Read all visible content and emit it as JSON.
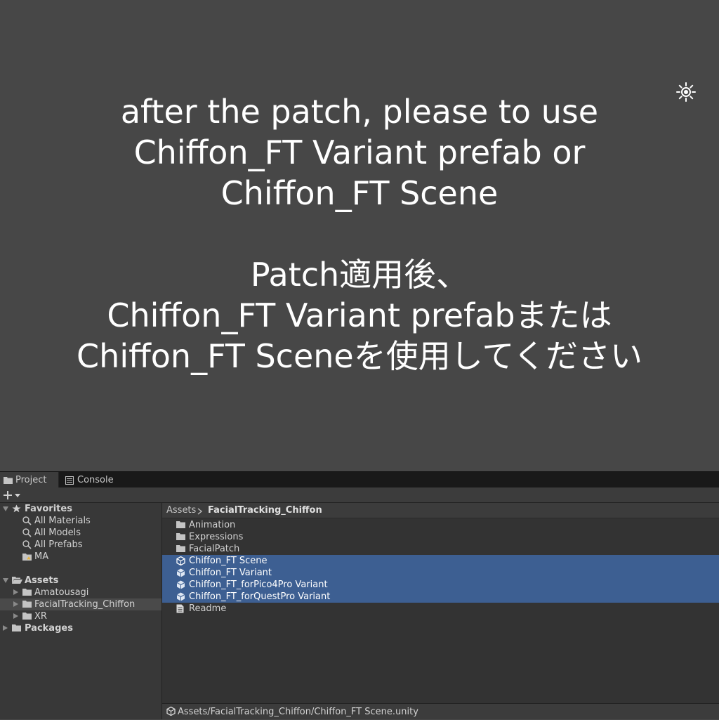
{
  "message": {
    "english_lines": [
      "after the patch, please to use",
      "Chiffon_FT Variant prefab or",
      "Chiffon_FT Scene"
    ],
    "japanese_lines": [
      "Patch適用後、",
      "Chiffon_FT Variant prefabまたは",
      "Chiffon_FT Sceneを使用してください"
    ],
    "icon": "sun-icon"
  },
  "tabs": [
    {
      "label": "Project",
      "icon": "folder-icon",
      "active": true
    },
    {
      "label": "Console",
      "icon": "console-icon",
      "active": false
    }
  ],
  "toolbar": {
    "add_icon": "plus-dropdown-icon"
  },
  "favorites": {
    "label": "Favorites",
    "items": [
      {
        "label": "All Materials",
        "icon": "search-icon"
      },
      {
        "label": "All Models",
        "icon": "search-icon"
      },
      {
        "label": "All Prefabs",
        "icon": "search-icon"
      },
      {
        "label": "MA",
        "icon": "folder-star-icon"
      }
    ]
  },
  "assets_tree": {
    "label": "Assets",
    "children": [
      {
        "label": "Amatousagi",
        "icon": "folder-icon"
      },
      {
        "label": "FacialTracking_Chiffon",
        "icon": "folder-icon",
        "selected": true
      },
      {
        "label": "XR",
        "icon": "folder-icon"
      }
    ]
  },
  "packages": {
    "label": "Packages"
  },
  "breadcrumb": {
    "root": "Assets",
    "current": "FacialTracking_Chiffon"
  },
  "files": [
    {
      "label": "Animation",
      "icon": "folder-icon",
      "selected": false
    },
    {
      "label": "Expressions",
      "icon": "folder-icon",
      "selected": false
    },
    {
      "label": "FacialPatch",
      "icon": "folder-icon",
      "selected": false
    },
    {
      "label": "Chiffon_FT Scene",
      "icon": "unity-scene-icon",
      "selected": true
    },
    {
      "label": "Chiffon_FT Variant",
      "icon": "prefab-variant-icon",
      "selected": true
    },
    {
      "label": "Chiffon_FT_forPico4Pro Variant",
      "icon": "prefab-variant-icon",
      "selected": true
    },
    {
      "label": "Chiffon_FT_forQuestPro Variant",
      "icon": "prefab-variant-icon",
      "selected": true
    },
    {
      "label": "Readme",
      "icon": "document-icon",
      "selected": false
    }
  ],
  "status_path": "Assets/FacialTracking_Chiffon/Chiffon_FT Scene.unity",
  "colors": {
    "selection": "#3d5f92",
    "background": "#474747"
  }
}
